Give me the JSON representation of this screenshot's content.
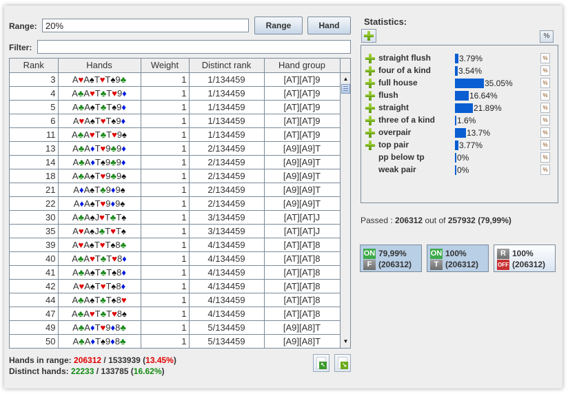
{
  "range": {
    "label": "Range:",
    "value": "20%"
  },
  "filter": {
    "label": "Filter:",
    "value": ""
  },
  "buttons": {
    "range": "Range",
    "hand": "Hand"
  },
  "table": {
    "columns": [
      "Rank",
      "Hands",
      "Weight",
      "Distinct rank",
      "Hand group"
    ],
    "rows": [
      {
        "rank": "3",
        "hand": "A♥A♠T♥T♠9♣",
        "weight": "1",
        "distinct": "1/134459",
        "group": "[AT][AT]9"
      },
      {
        "rank": "4",
        "hand": "A♣A♥T♣T♥9♦",
        "weight": "1",
        "distinct": "1/134459",
        "group": "[AT][AT]9"
      },
      {
        "rank": "5",
        "hand": "A♣A♠T♣T♠9♦",
        "weight": "1",
        "distinct": "1/134459",
        "group": "[AT][AT]9"
      },
      {
        "rank": "6",
        "hand": "A♥A♠T♥T♠9♦",
        "weight": "1",
        "distinct": "1/134459",
        "group": "[AT][AT]9"
      },
      {
        "rank": "11",
        "hand": "A♣A♥T♣T♥9♠",
        "weight": "1",
        "distinct": "1/134459",
        "group": "[AT][AT]9"
      },
      {
        "rank": "13",
        "hand": "A♣A♦T♥9♣9♦",
        "weight": "1",
        "distinct": "2/134459",
        "group": "[A9][A9]T"
      },
      {
        "rank": "14",
        "hand": "A♣A♦T♠9♣9♦",
        "weight": "1",
        "distinct": "2/134459",
        "group": "[A9][A9]T"
      },
      {
        "rank": "18",
        "hand": "A♣A♠T♥9♣9♠",
        "weight": "1",
        "distinct": "2/134459",
        "group": "[A9][A9]T"
      },
      {
        "rank": "21",
        "hand": "A♦A♠T♣9♦9♠",
        "weight": "1",
        "distinct": "2/134459",
        "group": "[A9][A9]T"
      },
      {
        "rank": "22",
        "hand": "A♦A♠T♥9♦9♠",
        "weight": "1",
        "distinct": "2/134459",
        "group": "[A9][A9]T"
      },
      {
        "rank": "30",
        "hand": "A♣A♠J♥T♣T♠",
        "weight": "1",
        "distinct": "3/134459",
        "group": "[AT][AT]J"
      },
      {
        "rank": "35",
        "hand": "A♥A♠J♣T♥T♠",
        "weight": "1",
        "distinct": "3/134459",
        "group": "[AT][AT]J"
      },
      {
        "rank": "39",
        "hand": "A♥A♠T♥T♠8♣",
        "weight": "1",
        "distinct": "4/134459",
        "group": "[AT][AT]8"
      },
      {
        "rank": "40",
        "hand": "A♣A♥T♣T♥8♦",
        "weight": "1",
        "distinct": "4/134459",
        "group": "[AT][AT]8"
      },
      {
        "rank": "41",
        "hand": "A♣A♠T♣T♠8♦",
        "weight": "1",
        "distinct": "4/134459",
        "group": "[AT][AT]8"
      },
      {
        "rank": "42",
        "hand": "A♥A♠T♥T♠8♦",
        "weight": "1",
        "distinct": "4/134459",
        "group": "[AT][AT]8"
      },
      {
        "rank": "44",
        "hand": "A♣A♠T♣T♠8♥",
        "weight": "1",
        "distinct": "4/134459",
        "group": "[AT][AT]8"
      },
      {
        "rank": "47",
        "hand": "A♣A♥T♣T♥8♠",
        "weight": "1",
        "distinct": "4/134459",
        "group": "[AT][AT]8"
      },
      {
        "rank": "49",
        "hand": "A♣A♦T♥9♦8♣",
        "weight": "1",
        "distinct": "5/134459",
        "group": "[A9][A8]T"
      },
      {
        "rank": "50",
        "hand": "A♣A♦T♠9♦8♣",
        "weight": "1",
        "distinct": "5/134459",
        "group": "[A9][A8]T"
      }
    ]
  },
  "footer": {
    "hands_label": "Hands in range:",
    "hands_in": "206312",
    "hands_total": "1533939",
    "hands_pct": "13.45%",
    "distinct_label": "Distinct hands:",
    "distinct_in": "22233",
    "distinct_total": "133785",
    "distinct_pct": "16.62%"
  },
  "icons": {
    "import": "import-icon",
    "export": "export-icon"
  },
  "statistics": {
    "title": "Statistics:",
    "pct_button": "%",
    "rows": [
      {
        "name": "straight flush",
        "value": 3.79,
        "label": "3.79%",
        "expandable": true
      },
      {
        "name": "four of a kind",
        "value": 3.54,
        "label": "3.54%",
        "expandable": true
      },
      {
        "name": "full house",
        "value": 35.05,
        "label": "35.05%",
        "expandable": true
      },
      {
        "name": "flush",
        "value": 16.64,
        "label": "16.64%",
        "expandable": true
      },
      {
        "name": "straight",
        "value": 21.89,
        "label": "21.89%",
        "expandable": true
      },
      {
        "name": "three of a kind",
        "value": 1.6,
        "label": "1.6%",
        "expandable": true
      },
      {
        "name": "overpair",
        "value": 13.7,
        "label": "13.7%",
        "expandable": true
      },
      {
        "name": "top pair",
        "value": 3.77,
        "label": "3.77%",
        "expandable": true
      },
      {
        "name": "pp below tp",
        "value": 0,
        "label": "0%",
        "expandable": false
      },
      {
        "name": "weak pair",
        "value": 0,
        "label": "0%",
        "expandable": false
      }
    ]
  },
  "passed": {
    "label": "Passed :",
    "count": "206312",
    "out_of": "out of",
    "total": "257932",
    "pct": "(79,99%)"
  },
  "filters": [
    {
      "tag1": "ON",
      "tag2": "F",
      "pct": "79,99%",
      "count": "(206312)"
    },
    {
      "tag1": "ON",
      "tag2": "T",
      "pct": "100%",
      "count": "(206312)"
    },
    {
      "tag1": "R",
      "tag2": "OFF",
      "pct": "100%",
      "count": "(206312)"
    }
  ],
  "colors": {
    "bar": "#0a5ed2",
    "hearts": "#e00000",
    "spades": "#111111",
    "clubs": "#1a8a1a",
    "diamonds": "#0018e0"
  }
}
